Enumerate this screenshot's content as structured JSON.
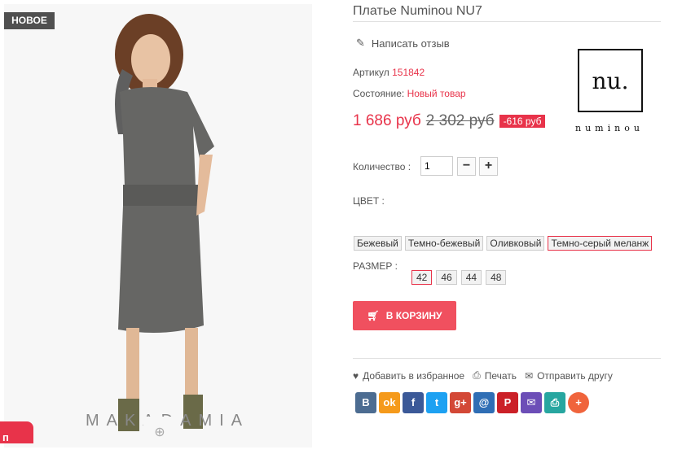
{
  "badge": "НОВОЕ",
  "image_watermark": "MAKADAMIA",
  "product": {
    "title": "Платье Numinou NU7",
    "review_link": "Написать отзыв",
    "sku_label": "Артикул",
    "sku_value": "151842",
    "condition_label": "Состояние:",
    "condition_value": "Новый товар",
    "price": "1 686 руб",
    "old_price": "2 302 руб",
    "discount": "-616 руб"
  },
  "brand": {
    "logo_text": "nu.",
    "name": "numinou"
  },
  "quantity": {
    "label": "Количество :",
    "value": "1",
    "minus": "−",
    "plus": "+"
  },
  "color": {
    "label": "ЦВЕТ :",
    "options": [
      "Бежевый",
      "Темно-бежевый",
      "Оливковый",
      "Темно-серый меланж"
    ],
    "selected": "Темно-серый меланж"
  },
  "size": {
    "label": "РАЗМЕР :",
    "options": [
      "42",
      "46",
      "44",
      "48"
    ],
    "selected": "42"
  },
  "cart_button": "В КОРЗИНУ",
  "actions": {
    "favorite": "Добавить в избранное",
    "print": "Печать",
    "send": "Отправить другу"
  },
  "share": [
    {
      "icon": "vk-icon",
      "glyph": "В",
      "color": "#4c6c91"
    },
    {
      "icon": "odnoklassniki-icon",
      "glyph": "ok",
      "color": "#f59a1b"
    },
    {
      "icon": "facebook-icon",
      "glyph": "f",
      "color": "#3b5998"
    },
    {
      "icon": "twitter-icon",
      "glyph": "t",
      "color": "#1da1f2"
    },
    {
      "icon": "google-plus-icon",
      "glyph": "g+",
      "color": "#d34836"
    },
    {
      "icon": "mail-ru-icon",
      "glyph": "@",
      "color": "#2f6eb5"
    },
    {
      "icon": "pinterest-icon",
      "glyph": "P",
      "color": "#cb2027"
    },
    {
      "icon": "email-icon",
      "glyph": "✉",
      "color": "#6c4eb7"
    },
    {
      "icon": "print-icon",
      "glyph": "⎙",
      "color": "#27a6a0"
    },
    {
      "icon": "add-more-icon",
      "glyph": "+",
      "color": "#f0643c"
    }
  ],
  "colors": {
    "accent": "#e8334a",
    "button": "#f0505f"
  }
}
